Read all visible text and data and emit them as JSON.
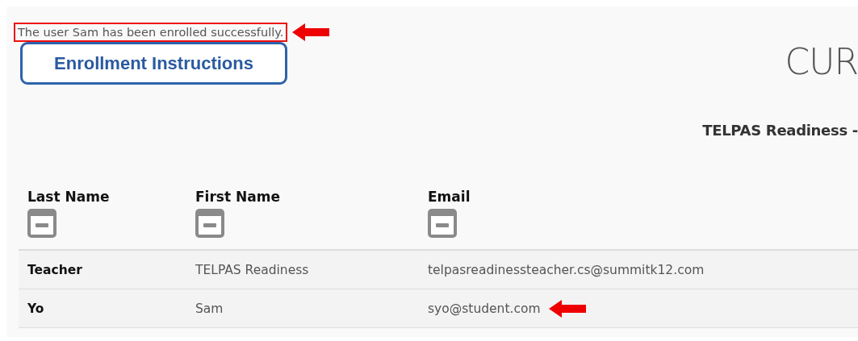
{
  "message": {
    "text": "The user Sam has been enrolled successfully.",
    "highlighted": true,
    "arrow": true
  },
  "instructions_button": {
    "label": "Enrollment Instructions"
  },
  "page_title": "CUR",
  "subtitle": "TELPAS Readiness -",
  "table": {
    "columns": [
      {
        "label": "Last Name"
      },
      {
        "label": "First Name"
      },
      {
        "label": "Email"
      }
    ],
    "rows": [
      {
        "cells": [
          "Teacher",
          "TELPAS Readiness",
          "telpasreadinessteacher.cs@summitk12.com"
        ],
        "arrow": false
      },
      {
        "cells": [
          "Yo",
          "Sam",
          "syo@student.com"
        ],
        "arrow": true
      }
    ]
  }
}
